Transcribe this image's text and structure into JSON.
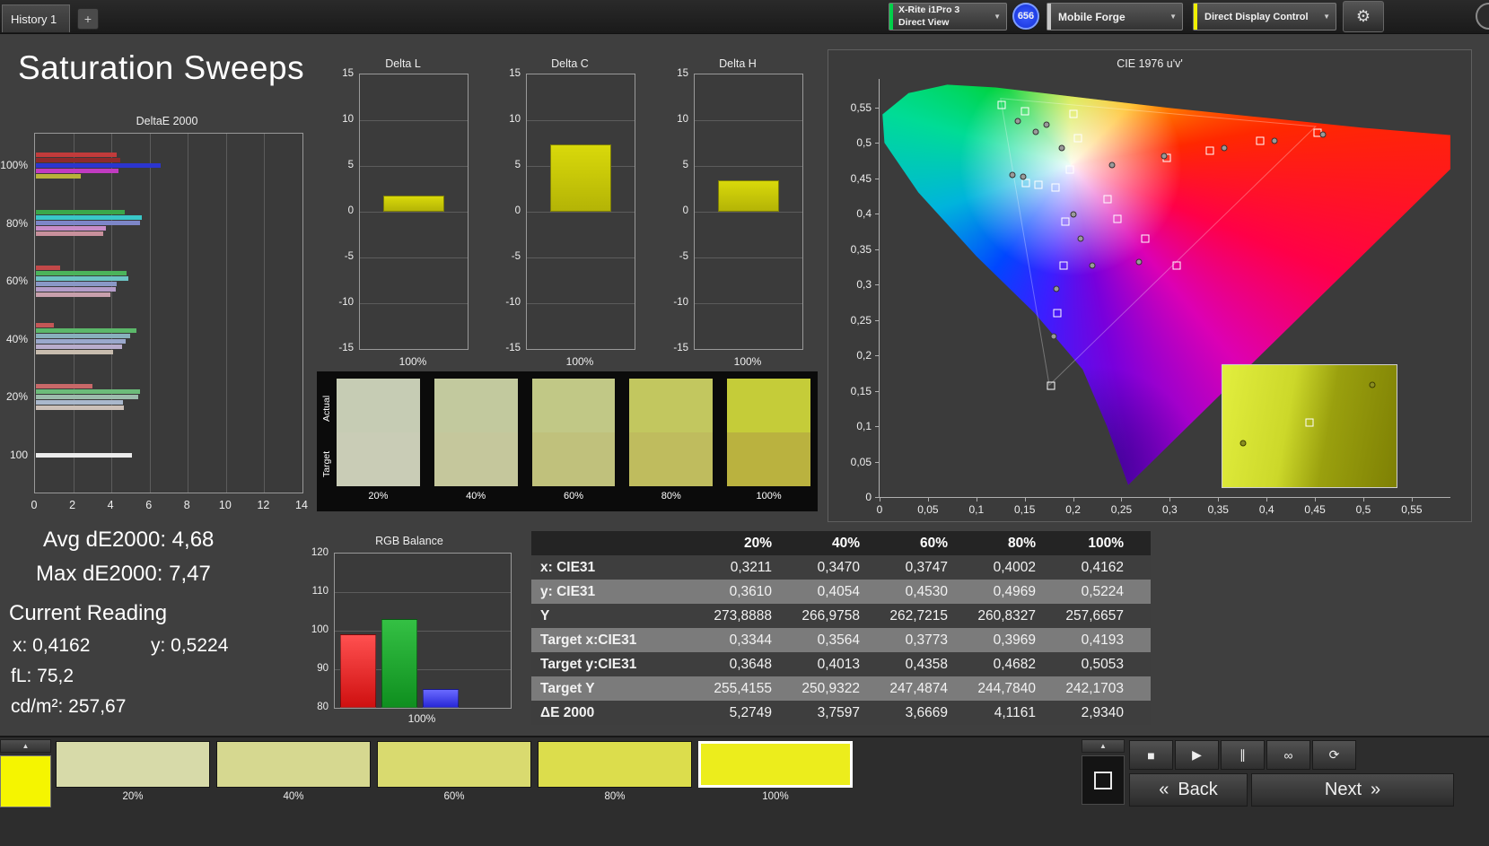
{
  "title": "Saturation Sweeps",
  "icons": {
    "gear": "⚙",
    "caret": "▼",
    "collapse": "▲",
    "plus": "+"
  },
  "top_bar": {
    "tab": "History 1",
    "add_tab": "+",
    "meter": {
      "line1": "X-Rite i1Pro 3",
      "line2": "Direct View",
      "status_color": "#00d04a"
    },
    "badge": "656",
    "source": {
      "label": "Mobile Forge",
      "status_color": "#c8c8c8"
    },
    "display_control": {
      "label": "Direct Display Control",
      "status_color": "#f0f000"
    }
  },
  "deltae_chart": {
    "title": "DeltaE 2000",
    "x_ticks": [
      "0",
      "2",
      "4",
      "6",
      "8",
      "10",
      "12",
      "14"
    ],
    "x_max": 14,
    "groups": [
      {
        "label": "100%",
        "bars": [
          {
            "c": "#c23b3b",
            "v": 4.25
          },
          {
            "c": "#8e2a2a",
            "v": 4.4
          },
          {
            "c": "#2b35cf",
            "v": 6.55
          },
          {
            "c": "#c13bc1",
            "v": 4.3
          },
          {
            "c": "#b9b23a",
            "v": 2.35
          }
        ]
      },
      {
        "label": "80%",
        "bars": [
          {
            "c": "#3aa84a",
            "v": 4.65
          },
          {
            "c": "#39c8c8",
            "v": 5.55
          },
          {
            "c": "#7d86c8",
            "v": 5.45
          },
          {
            "c": "#c88cc8",
            "v": 3.65
          },
          {
            "c": "#c8909c",
            "v": 3.5
          }
        ]
      },
      {
        "label": "60%",
        "bars": [
          {
            "c": "#c24848",
            "v": 1.25
          },
          {
            "c": "#4bb45b",
            "v": 4.75
          },
          {
            "c": "#6cc4c4",
            "v": 4.85
          },
          {
            "c": "#8a98c6",
            "v": 4.25
          },
          {
            "c": "#b49cc8",
            "v": 4.2
          },
          {
            "c": "#c8a0ac",
            "v": 3.9
          }
        ]
      },
      {
        "label": "40%",
        "bars": [
          {
            "c": "#c45656",
            "v": 0.95
          },
          {
            "c": "#5cb86a",
            "v": 5.25
          },
          {
            "c": "#88b0bc",
            "v": 4.95
          },
          {
            "c": "#9aa8cc",
            "v": 4.7
          },
          {
            "c": "#b8accc",
            "v": 4.5
          },
          {
            "c": "#c8bcae",
            "v": 4.05
          }
        ]
      },
      {
        "label": "20%",
        "bars": [
          {
            "c": "#c86868",
            "v": 2.95
          },
          {
            "c": "#6cbc7a",
            "v": 5.45
          },
          {
            "c": "#9cbcac",
            "v": 5.35
          },
          {
            "c": "#aab8cc",
            "v": 4.55
          },
          {
            "c": "#ccc0b8",
            "v": 4.6
          }
        ]
      },
      {
        "label": "100",
        "bars": [
          {
            "c": "#ececec",
            "v": 5.05
          }
        ]
      }
    ]
  },
  "delta_axis": {
    "ticks": [
      "15",
      "10",
      "5",
      "0",
      "-5",
      "-10",
      "-15"
    ],
    "max": 15
  },
  "delta_charts": [
    {
      "title": "Delta L",
      "value": 1.8,
      "x_label": "100%"
    },
    {
      "title": "Delta C",
      "value": 7.4,
      "x_label": "100%"
    },
    {
      "title": "Delta H",
      "value": 3.4,
      "x_label": "100%"
    }
  ],
  "patches": {
    "actual_label": "Actual",
    "target_label": "Target",
    "columns": [
      {
        "label": "20%",
        "actual": "#c6ccb4",
        "target": "#c9ccb6"
      },
      {
        "label": "40%",
        "actual": "#c2c99e",
        "target": "#c5c79c"
      },
      {
        "label": "60%",
        "actual": "#c1c886",
        "target": "#c0c17c"
      },
      {
        "label": "80%",
        "actual": "#c2c75f",
        "target": "#bfbc5e"
      },
      {
        "label": "100%",
        "actual": "#c5cc39",
        "target": "#bab23f"
      }
    ]
  },
  "stats": {
    "avg": "Avg dE2000: 4,68",
    "max": "Max dE2000: 7,47",
    "current_heading": "Current Reading",
    "x": "x: 0,4162",
    "y": "y: 0,5224",
    "fl": "fL: 75,2",
    "cd": "cd/m²: 257,67"
  },
  "rgb_chart": {
    "title": "RGB Balance",
    "ticks": [
      "120",
      "110",
      "100",
      "90",
      "80"
    ],
    "min": 80,
    "max": 120,
    "x_label": "100%",
    "bars": [
      {
        "name": "red",
        "v": 99,
        "c1": "#ff5050",
        "c2": "#cf1010"
      },
      {
        "name": "green",
        "v": 103,
        "c1": "#34c044",
        "c2": "#0f8f1f"
      },
      {
        "name": "blue",
        "v": 85,
        "c1": "#6a6aff",
        "c2": "#2828d8"
      }
    ]
  },
  "table": {
    "header": [
      "",
      "20%",
      "40%",
      "60%",
      "80%",
      "100%"
    ],
    "rows": [
      {
        "label": "x: CIE31",
        "values": [
          "0,3211",
          "0,3470",
          "0,3747",
          "0,4002",
          "0,4162"
        ]
      },
      {
        "label": "y: CIE31",
        "values": [
          "0,3610",
          "0,4054",
          "0,4530",
          "0,4969",
          "0,5224"
        ]
      },
      {
        "label": "Y",
        "values": [
          "273,8888",
          "266,9758",
          "262,7215",
          "260,8327",
          "257,6657"
        ]
      },
      {
        "label": "Target x:CIE31",
        "values": [
          "0,3344",
          "0,3564",
          "0,3773",
          "0,3969",
          "0,4193"
        ]
      },
      {
        "label": "Target y:CIE31",
        "values": [
          "0,3648",
          "0,4013",
          "0,4358",
          "0,4682",
          "0,5053"
        ]
      },
      {
        "label": "Target Y",
        "values": [
          "255,4155",
          "250,9322",
          "247,4874",
          "244,7840",
          "242,1703"
        ]
      },
      {
        "label": "ΔE 2000",
        "values": [
          "5,2749",
          "3,7597",
          "3,6669",
          "4,1161",
          "2,9340"
        ]
      }
    ]
  },
  "cie": {
    "title": "CIE 1976 u'v'",
    "axis_max": 0.59,
    "y_ticks": [
      "0",
      "0,05",
      "0,1",
      "0,15",
      "0,2",
      "0,25",
      "0,3",
      "0,35",
      "0,4",
      "0,45",
      "0,5",
      "0,55"
    ],
    "x_ticks": [
      "0",
      "0,05",
      "0,1",
      "0,15",
      "0,2",
      "0,25",
      "0,3",
      "0,35",
      "0,4",
      "0,45",
      "0,5",
      "0,55"
    ],
    "locus": [
      [
        0.257,
        0.017
      ],
      [
        0.235,
        0.1
      ],
      [
        0.21,
        0.18
      ],
      [
        0.16,
        0.26
      ],
      [
        0.1,
        0.34
      ],
      [
        0.04,
        0.43
      ],
      [
        0.005,
        0.5
      ],
      [
        0.003,
        0.54
      ],
      [
        0.03,
        0.57
      ],
      [
        0.07,
        0.582
      ],
      [
        0.12,
        0.578
      ],
      [
        0.2,
        0.565
      ],
      [
        0.3,
        0.549
      ],
      [
        0.4,
        0.535
      ],
      [
        0.5,
        0.521
      ],
      [
        0.623,
        0.507
      ]
    ],
    "triangle": [
      [
        0.4507,
        0.5229
      ],
      [
        0.125,
        0.5625
      ],
      [
        0.1754,
        0.1579
      ]
    ],
    "squares": [
      [
        0.126,
        0.553
      ],
      [
        0.15,
        0.545
      ],
      [
        0.2,
        0.541
      ],
      [
        0.205,
        0.506
      ],
      [
        0.197,
        0.462
      ],
      [
        0.236,
        0.42
      ],
      [
        0.246,
        0.392
      ],
      [
        0.275,
        0.365
      ],
      [
        0.307,
        0.327
      ],
      [
        0.192,
        0.389
      ],
      [
        0.19,
        0.327
      ],
      [
        0.184,
        0.26
      ],
      [
        0.177,
        0.157
      ],
      [
        0.297,
        0.478
      ],
      [
        0.341,
        0.489
      ],
      [
        0.393,
        0.503
      ],
      [
        0.453,
        0.514
      ],
      [
        0.151,
        0.443
      ],
      [
        0.164,
        0.44
      ],
      [
        0.182,
        0.437
      ]
    ],
    "circles": [
      [
        0.173,
        0.525
      ],
      [
        0.188,
        0.493
      ],
      [
        0.143,
        0.531
      ],
      [
        0.161,
        0.515
      ],
      [
        0.24,
        0.468
      ],
      [
        0.294,
        0.481
      ],
      [
        0.356,
        0.493
      ],
      [
        0.408,
        0.503
      ],
      [
        0.458,
        0.512
      ],
      [
        0.2,
        0.399
      ],
      [
        0.208,
        0.365
      ],
      [
        0.22,
        0.327
      ],
      [
        0.268,
        0.332
      ],
      [
        0.183,
        0.294
      ],
      [
        0.18,
        0.226
      ],
      [
        0.137,
        0.455
      ],
      [
        0.148,
        0.452
      ]
    ],
    "inset": {
      "squares": [
        [
          50,
          47
        ]
      ],
      "circles": [
        [
          86,
          16
        ],
        [
          12,
          64
        ]
      ]
    }
  },
  "bottom": {
    "current_patch_color": "#f5f500",
    "patch_buttons": [
      {
        "label": "20%",
        "color": "#d7daa9",
        "selected": false
      },
      {
        "label": "40%",
        "color": "#d6d890",
        "selected": false
      },
      {
        "label": "60%",
        "color": "#d9da6f",
        "selected": false
      },
      {
        "label": "80%",
        "color": "#dcdd4c",
        "selected": false
      },
      {
        "label": "100%",
        "color": "#eced1c",
        "selected": true
      }
    ],
    "transport": [
      {
        "name": "stop",
        "glyph": "■"
      },
      {
        "name": "play",
        "glyph": "▶"
      },
      {
        "name": "pause",
        "glyph": "∥"
      },
      {
        "name": "continuous-measure",
        "glyph": "∞"
      },
      {
        "name": "refresh",
        "glyph": "⟳"
      }
    ],
    "back_glyph": "«",
    "back_label": "Back",
    "next_label": "Next",
    "next_glyph": "»"
  }
}
